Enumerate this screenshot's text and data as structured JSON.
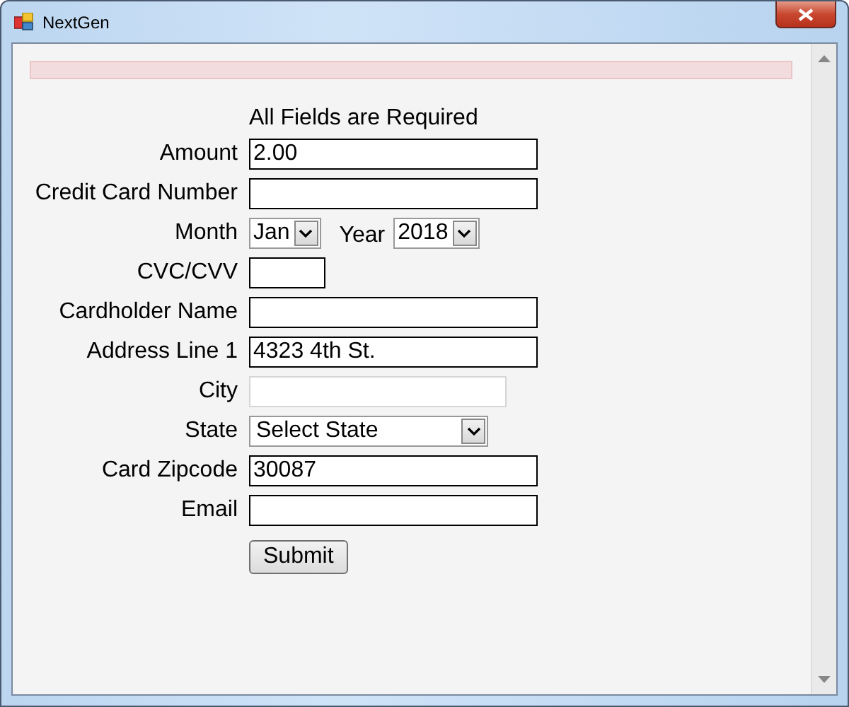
{
  "window": {
    "title": "NextGen"
  },
  "notice": "All Fields are Required",
  "fields": [
    {
      "kind": "text",
      "label": "Amount",
      "value": "2.00",
      "disabled": false
    },
    {
      "kind": "text",
      "label": "Credit Card Number",
      "disabled": false
    },
    {
      "kind": "month-year",
      "label": "Month",
      "month": "Jan",
      "year_label": "Year",
      "year": "2018"
    },
    {
      "kind": "short-text",
      "label": "CVC/CVV",
      "disabled": false
    },
    {
      "kind": "text",
      "label": "Cardholder Name",
      "disabled": false
    },
    {
      "kind": "text",
      "label": "Address Line 1",
      "value": "4323 4th St.",
      "disabled": false
    },
    {
      "kind": "text",
      "label": "City",
      "disabled": true
    },
    {
      "kind": "select",
      "label": "State",
      "value": "Select State"
    },
    {
      "kind": "text",
      "label": "Card Zipcode",
      "value": "30087",
      "disabled": false
    },
    {
      "kind": "text",
      "label": "Email",
      "disabled": false
    }
  ],
  "submit": "Submit"
}
